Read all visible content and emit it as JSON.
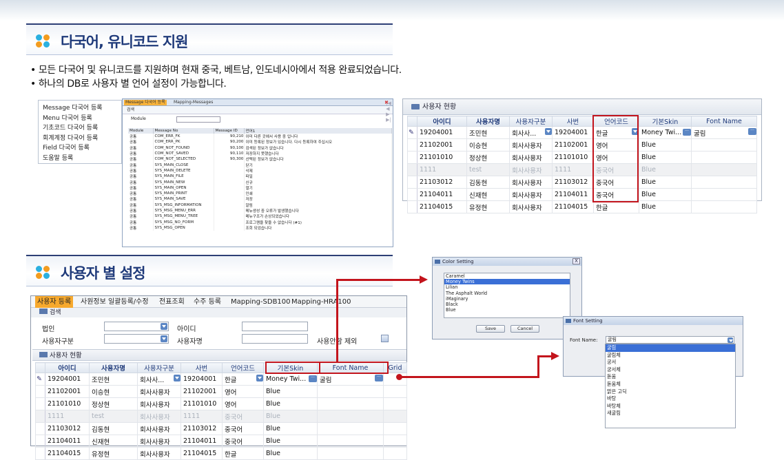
{
  "section1": {
    "title": "다국어, 유니코드 지원"
  },
  "bullets": [
    "• 모든 다국어 및 유니코드를 지원하며 현재 중국, 베트남, 인도네시아에서 적용 완료되었습니다.",
    "• 하나의 DB로 사용자 별 언어 설정이 가능합니다."
  ],
  "menu_items": [
    "Message 다국어 등록",
    "Menu 다국어 등록",
    "기초코드 다국어 등록",
    "회계계정 다국어 등록",
    "Field 다국어 등록",
    "도움말 등록"
  ],
  "msg_window": {
    "tabs": [
      "Message 다국어 등록",
      "Mapping-Messages"
    ],
    "nav": "|◀ ◀ ▶ ▶|",
    "close": "✖",
    "search": "검색",
    "module_label": "Module",
    "columns": [
      "Module",
      "Message No",
      "Message ID",
      "언어1"
    ],
    "rows": [
      [
        "공통",
        "COM_ERR_FK",
        "90,210",
        "이미 다른 곳에서 사용 중 입니다"
      ],
      [
        "공통",
        "COM_ERR_PK",
        "90,200",
        "이미 등록된 정보가 있습니다. 다시 등록하여 주십시오"
      ],
      [
        "공통",
        "COM_NOT_FOUND",
        "90,100",
        "검색된 정보가 없습니다"
      ],
      [
        "공통",
        "COM_NOT_SAVED",
        "90,110",
        "저장하지 못했습니다"
      ],
      [
        "공통",
        "COM_NOT_SELECTED",
        "90,300",
        "선택된 정보가 없습니다"
      ],
      [
        "공통",
        "SYS_MAIN_CLOSE",
        "",
        "닫기"
      ],
      [
        "공통",
        "SYS_MAIN_DELETE",
        "",
        "삭제"
      ],
      [
        "공통",
        "SYS_MAIN_FILE",
        "",
        "파일"
      ],
      [
        "공통",
        "SYS_MAIN_NEW",
        "",
        "신규"
      ],
      [
        "공통",
        "SYS_MAIN_OPEN",
        "",
        "열기"
      ],
      [
        "공통",
        "SYS_MAIN_PRINT",
        "",
        "인쇄"
      ],
      [
        "공통",
        "SYS_MAIN_SAVE",
        "",
        "저장"
      ],
      [
        "공통",
        "SYS_MSG_INFORMATION",
        "",
        "알림"
      ],
      [
        "공통",
        "SYS_MSG_MENU_ERR",
        "",
        "메뉴생성 중 오류가 발생했습니다"
      ],
      [
        "공통",
        "SYS_MSG_MENU_TREE",
        "",
        "메뉴구조가 손상되었습니다"
      ],
      [
        "공통",
        "SYS_MSG_NO_FORM",
        "",
        "프로그램을 찾을 수 없습니다 (#1)"
      ],
      [
        "공통",
        "SYS_MSG_OPEN",
        "",
        "조회 되었습니다"
      ]
    ]
  },
  "user_status": {
    "title": "사용자 현황",
    "columns": [
      "아이디",
      "사용자명",
      "사용자구분",
      "사번",
      "언어코드",
      "기본Skin",
      "Font Name"
    ],
    "rows": [
      [
        "19204001",
        "조민현",
        "회사사...",
        "19204001",
        "한글",
        "Money Twi...",
        "굴림"
      ],
      [
        "21102001",
        "이승현",
        "회사사용자",
        "21102001",
        "영어",
        "Blue",
        ""
      ],
      [
        "21101010",
        "정상현",
        "회사사용자",
        "21101010",
        "영어",
        "Blue",
        ""
      ],
      [
        "1111",
        "test",
        "회사사용자",
        "1111",
        "중국어",
        "Blue",
        ""
      ],
      [
        "21103012",
        "김동현",
        "회사사용자",
        "21103012",
        "중국어",
        "Blue",
        ""
      ],
      [
        "21104011",
        "신재현",
        "회사사용자",
        "21104011",
        "중국어",
        "Blue",
        ""
      ],
      [
        "21104015",
        "유정현",
        "회사사용자",
        "21104015",
        "한글",
        "Blue",
        ""
      ]
    ]
  },
  "section2": {
    "title": "사용자 별 설정"
  },
  "reg_window": {
    "tabs": [
      "사용자 등록",
      "사원정보 일괄등록/수정",
      "전표조회",
      "수주 등록",
      "Mapping-SDB100",
      "Mapping-HRA100"
    ],
    "search": "검색",
    "labels": {
      "corp": "법인",
      "user_id": "아이디",
      "user_type": "사용자구분",
      "user_name": "사용자명",
      "exclude": "사용안함 제외"
    },
    "sub_title": "사용자 현황",
    "extra_col": "Grid"
  },
  "color_dialog": {
    "title": "Color Setting",
    "close": "X",
    "items": [
      "Caramel",
      "Money Twins",
      "Lilian",
      "The Asphalt World",
      "iMaginary",
      "Black",
      "Blue"
    ],
    "selected": "Money Twins",
    "save": "Save",
    "cancel": "Cancel"
  },
  "font_dialog": {
    "title": "Font Setting",
    "label": "Font Name:",
    "value": "굴림",
    "items": [
      "굴림",
      "굴림체",
      "궁서",
      "궁서체",
      "돋움",
      "돋움체",
      "맑은 고딕",
      "바탕",
      "바탕체",
      "새굴림"
    ],
    "selected": "굴림"
  },
  "colors": {
    "accent": "#c3141c",
    "brand": "#1f3a7a",
    "tab_active": "#f7a92d"
  }
}
